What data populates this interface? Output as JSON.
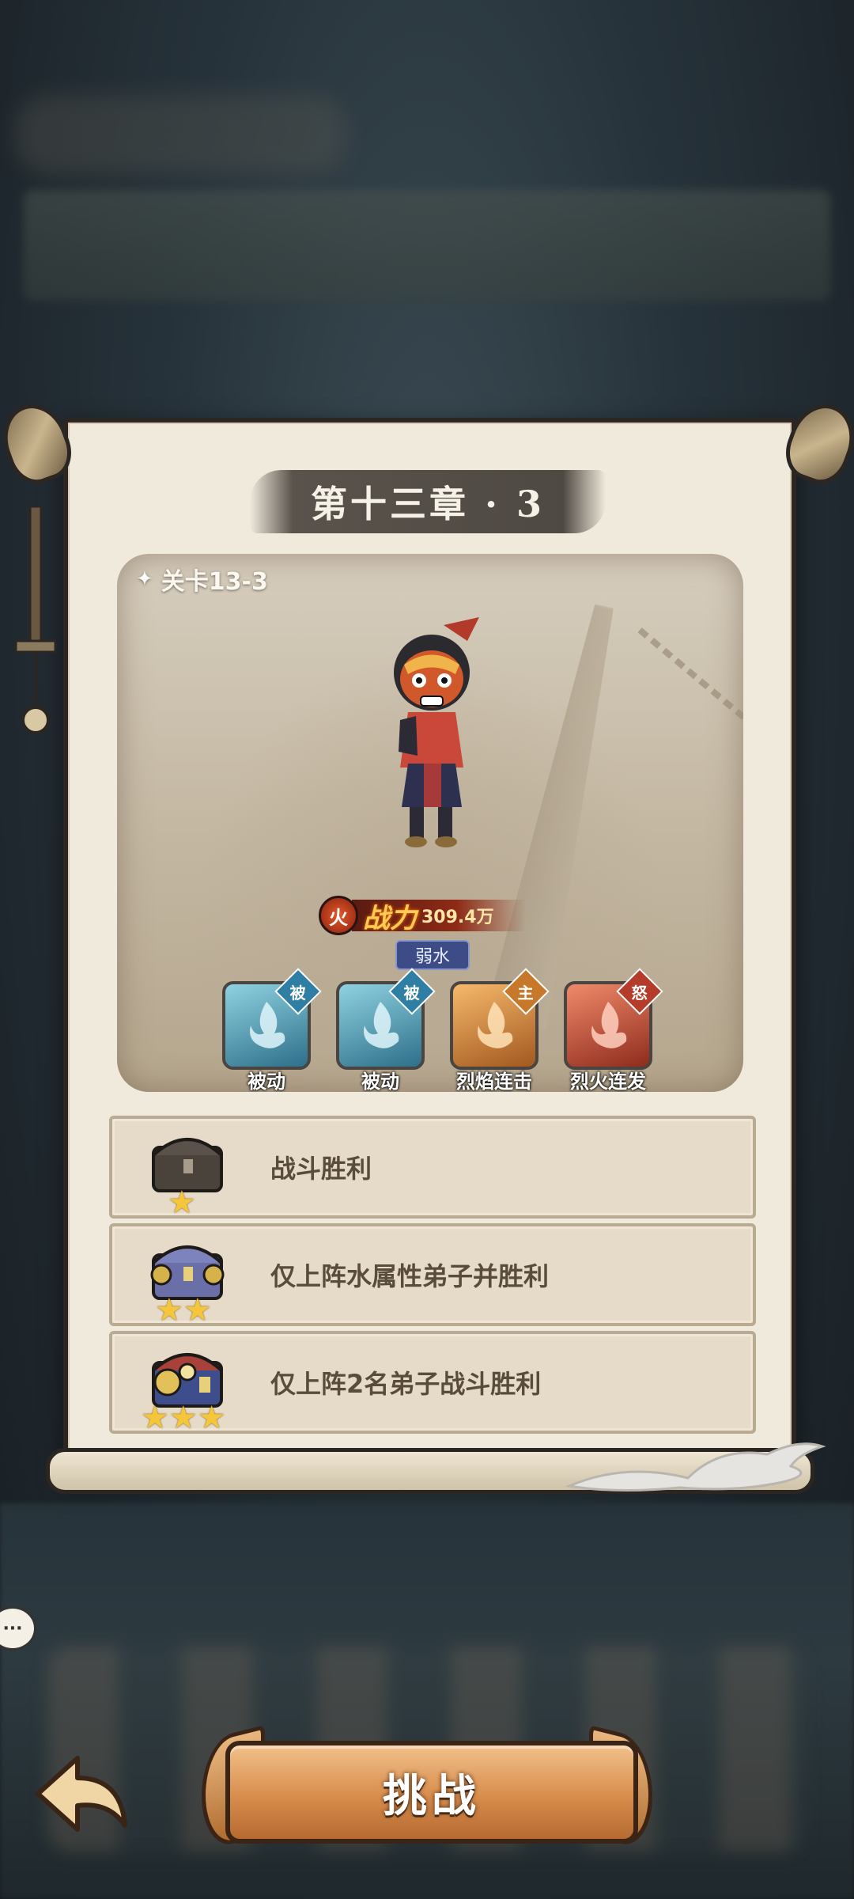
{
  "chapter_title": "第十三章 · 3",
  "stage": {
    "label": "关卡13-3",
    "element": "火",
    "power_word": "战力",
    "power_value": "309.4万",
    "weakness": "弱水"
  },
  "skills": [
    {
      "name": "被动",
      "tag": "被",
      "color": "blue"
    },
    {
      "name": "被动",
      "tag": "被",
      "color": "blue"
    },
    {
      "name": "烈焰连击",
      "tag": "主",
      "color": "orange"
    },
    {
      "name": "烈火连发",
      "tag": "怒",
      "color": "red"
    }
  ],
  "objectives": [
    {
      "text": "战斗胜利",
      "stars": 1
    },
    {
      "text": "仅上阵水属性弟子并胜利",
      "stars": 2
    },
    {
      "text": "仅上阵2名弟子战斗胜利",
      "stars": 3
    }
  ],
  "buttons": {
    "challenge": "挑战",
    "chat": "···"
  },
  "colors": {
    "parchment": "#f0eadc",
    "objective_bg": "#e6dbc8",
    "star": "#f5c53a",
    "button_orange": "#d88d4c"
  }
}
